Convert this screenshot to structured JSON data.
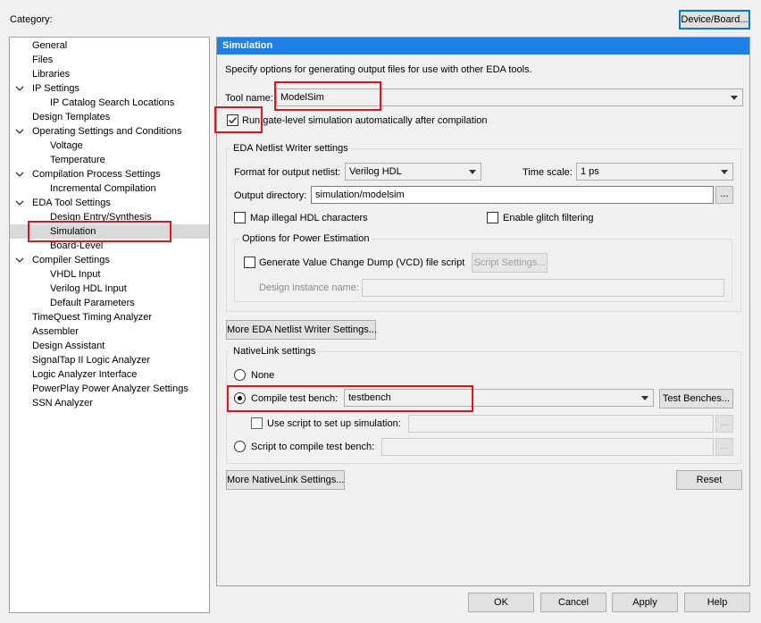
{
  "category_label": "Category:",
  "device_board_button": "Device/Board...",
  "tree": [
    {
      "label": "General",
      "level": 1,
      "expander": false
    },
    {
      "label": "Files",
      "level": 1,
      "expander": false
    },
    {
      "label": "Libraries",
      "level": 1,
      "expander": false
    },
    {
      "label": "IP Settings",
      "level": 1,
      "expander": true
    },
    {
      "label": "IP Catalog Search Locations",
      "level": 2,
      "expander": false
    },
    {
      "label": "Design Templates",
      "level": 1,
      "expander": false
    },
    {
      "label": "Operating Settings and Conditions",
      "level": 1,
      "expander": true
    },
    {
      "label": "Voltage",
      "level": 2,
      "expander": false
    },
    {
      "label": "Temperature",
      "level": 2,
      "expander": false
    },
    {
      "label": "Compilation Process Settings",
      "level": 1,
      "expander": true
    },
    {
      "label": "Incremental Compilation",
      "level": 2,
      "expander": false
    },
    {
      "label": "EDA Tool Settings",
      "level": 1,
      "expander": true
    },
    {
      "label": "Design Entry/Synthesis",
      "level": 2,
      "expander": false
    },
    {
      "label": "Simulation",
      "level": 2,
      "expander": false,
      "selected": true
    },
    {
      "label": "Board-Level",
      "level": 2,
      "expander": false
    },
    {
      "label": "Compiler Settings",
      "level": 1,
      "expander": true
    },
    {
      "label": "VHDL Input",
      "level": 2,
      "expander": false
    },
    {
      "label": "Verilog HDL Input",
      "level": 2,
      "expander": false
    },
    {
      "label": "Default Parameters",
      "level": 2,
      "expander": false
    },
    {
      "label": "TimeQuest Timing Analyzer",
      "level": 1,
      "expander": false
    },
    {
      "label": "Assembler",
      "level": 1,
      "expander": false
    },
    {
      "label": "Design Assistant",
      "level": 1,
      "expander": false
    },
    {
      "label": "SignalTap II Logic Analyzer",
      "level": 1,
      "expander": false
    },
    {
      "label": "Logic Analyzer Interface",
      "level": 1,
      "expander": false
    },
    {
      "label": "PowerPlay Power Analyzer Settings",
      "level": 1,
      "expander": false
    },
    {
      "label": "SSN Analyzer",
      "level": 1,
      "expander": false
    }
  ],
  "panel": {
    "title": "Simulation",
    "description": "Specify options for generating output files for use with other EDA tools.",
    "tool_name_label": "Tool name:",
    "tool_name_value": "ModelSim",
    "run_gate_level_label": "Run gate-level simulation automatically after compilation",
    "run_gate_level_checked": true,
    "netlist": {
      "title": "EDA Netlist Writer settings",
      "format_label": "Format for output netlist:",
      "format_value": "Verilog HDL",
      "time_scale_label": "Time scale:",
      "time_scale_value": "1 ps",
      "output_dir_label": "Output directory:",
      "output_dir_value": "simulation/modelsim",
      "ellipsis": "...",
      "map_illegal_label": "Map illegal HDL characters",
      "glitch_label": "Enable glitch filtering",
      "power": {
        "title": "Options for Power Estimation",
        "vcd_label": "Generate Value Change Dump (VCD) file script",
        "script_settings_button": "Script Settings...",
        "design_instance_label": "Design instance name:",
        "design_instance_value": ""
      }
    },
    "more_netlist_button": "More EDA Netlist Writer Settings...",
    "nativelink": {
      "title": "NativeLink settings",
      "none_label": "None",
      "compile_tb_label": "Compile test bench:",
      "compile_tb_value": "testbench",
      "test_benches_button": "Test Benches...",
      "use_script_label": "Use script to set up simulation:",
      "use_script_value": "",
      "script_compile_label": "Script to compile test bench:",
      "script_compile_value": "",
      "selected": "compile_tb"
    },
    "more_nativelink_button": "More NativeLink Settings...",
    "reset_button": "Reset"
  },
  "footer": {
    "ok": "OK",
    "cancel": "Cancel",
    "apply": "Apply",
    "help": "Help"
  },
  "colors": {
    "header_blue": "#1e7fe6",
    "highlight_red": "#e0141e",
    "focus_blue": "#0078d7"
  }
}
